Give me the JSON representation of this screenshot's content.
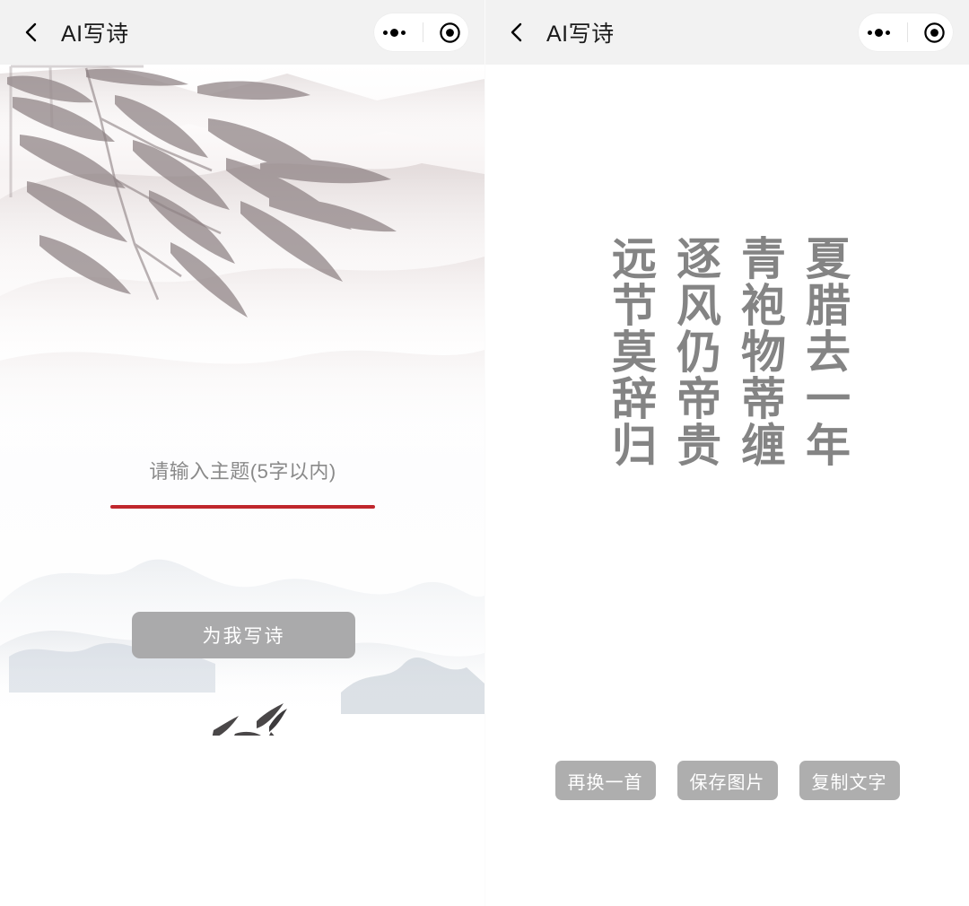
{
  "app": {
    "title": "AI写诗",
    "back_icon": "chevron-left-icon",
    "capsule": {
      "more_icon": "more-dots-icon",
      "target_icon": "target-circle-icon"
    }
  },
  "colors": {
    "navbar_bg": "#f2f2f2",
    "accent_red": "#c0272d",
    "button_gray": "#aaaaab",
    "action_button_gray": "#aeaeae",
    "poem_text": "#848484",
    "title_text": "#1a1a1a",
    "placeholder_text": "#8a8a8a"
  },
  "left_screen": {
    "input": {
      "value": "",
      "placeholder": "请输入主题(5字以内)"
    },
    "primary_button": {
      "label": "为我写诗"
    },
    "artwork": {
      "description": "ink-wash-landscape",
      "elements": [
        "bamboo-leaves",
        "misty-mountains",
        "flying-birds"
      ]
    }
  },
  "right_screen": {
    "poem": {
      "lines": [
        "夏腊去一年",
        "青袍物蒂缠",
        "逐风仍帝贵",
        "远节莫辞归"
      ]
    },
    "actions": [
      {
        "label": "再换一首",
        "name": "regenerate-poem-button"
      },
      {
        "label": "保存图片",
        "name": "save-image-button"
      },
      {
        "label": "复制文字",
        "name": "copy-text-button"
      }
    ]
  }
}
